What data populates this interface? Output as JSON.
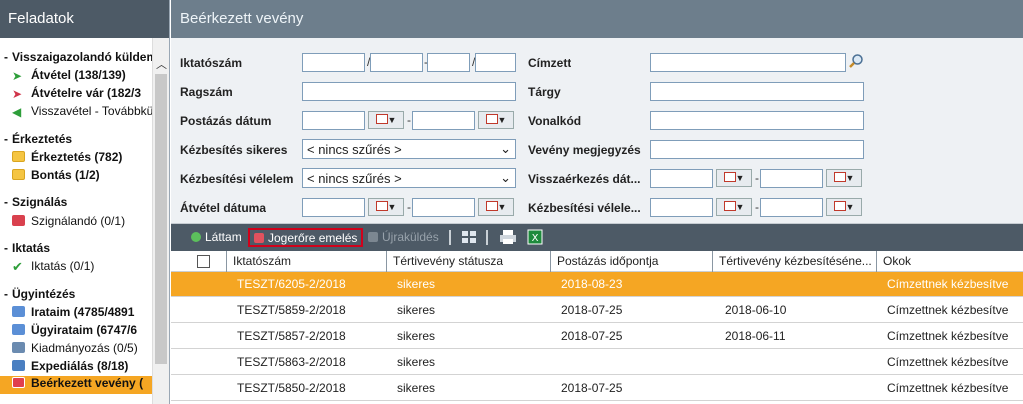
{
  "left": {
    "title": "Feladatok",
    "groups": [
      {
        "label": "Visszaigazolandó küldemények",
        "items": [
          {
            "label": "Átvétel (138/139)",
            "icon": "arrow-right-green-icon",
            "bold": true
          },
          {
            "label": "Átvételre vár (182/3",
            "icon": "arrow-right-red-icon",
            "bold": true
          },
          {
            "label": "Visszavétel - Továbbküldés",
            "icon": "arrow-left-green-icon",
            "bold": false
          }
        ]
      },
      {
        "label": "Érkeztetés",
        "items": [
          {
            "label": "Érkeztetés (782)",
            "icon": "folder-icon",
            "bold": true
          },
          {
            "label": "Bontás (1/2)",
            "icon": "folder-icon",
            "bold": true
          }
        ]
      },
      {
        "label": "Szignálás",
        "items": [
          {
            "label": "Szignálandó (0/1)",
            "icon": "mail-red-icon",
            "bold": false
          }
        ]
      },
      {
        "label": "Iktatás",
        "items": [
          {
            "label": "Iktatás (0/1)",
            "icon": "check-icon",
            "bold": false
          }
        ]
      },
      {
        "label": "Ügyintézés",
        "items": [
          {
            "label": "Irataim (4785/4891",
            "icon": "document-blue-icon",
            "bold": true
          },
          {
            "label": "Ügyirataim (6747/6",
            "icon": "document-blue-icon",
            "bold": true
          },
          {
            "label": "Kiadmányozás (0/5)",
            "icon": "stamp-icon",
            "bold": false
          },
          {
            "label": "Expediálás (8/18)",
            "icon": "send-icon",
            "bold": true
          },
          {
            "label": "Beérkezett vevény (",
            "icon": "receipt-red-icon",
            "bold": true,
            "selected": true
          }
        ]
      }
    ]
  },
  "right": {
    "title": "Beérkezett vevény"
  },
  "filter": {
    "iktatoszam": "Iktatószám",
    "iktatoszam_sep1": "/",
    "iktatoszam_sep2": "-",
    "iktatoszam_sep3": "/",
    "cimzett": "Címzett",
    "ragszam": "Ragszám",
    "targy": "Tárgy",
    "postazas_datum": "Postázás dátum",
    "vonalkod": "Vonalkód",
    "kezbesites_sikeres": "Kézbesítés sikeres",
    "kezbesites_sikeres_value": "< nincs szűrés >",
    "veveny_megjegyzes": "Vevény megjegyzés",
    "kezbesitesi_velelem": "Kézbesítési vélelem",
    "kezbesitesi_velelem_value": "< nincs szűrés >",
    "visszaerkezes_dat": "Visszaérkezés dát...",
    "atvetel_datuma": "Átvétel dátuma",
    "kezbesitesi_velele": "Kézbesítési vélele...",
    "range_sep": "-"
  },
  "toolbar": {
    "lattam": "Láttam",
    "jogerore_emeles": "Jogerőre emelés",
    "ujrakuldes": "Újraküldés"
  },
  "table": {
    "columns": [
      "Iktatószám",
      "Tértivevény státusza",
      "Postázás időpontja",
      "Tértivevény kézbesítéséne...",
      "Okok"
    ],
    "rows": [
      {
        "iktatoszam": "TESZT/6205-2/2018",
        "statusz": "sikeres",
        "postazas": "2018-08-23",
        "kezbesites": "",
        "okok": "Címzettnek kézbesítve",
        "selected": true
      },
      {
        "iktatoszam": "TESZT/5859-2/2018",
        "statusz": "sikeres",
        "postazas": "2018-07-25",
        "kezbesites": "2018-06-10",
        "okok": "Címzettnek kézbesítve"
      },
      {
        "iktatoszam": "TESZT/5857-2/2018",
        "statusz": "sikeres",
        "postazas": "2018-07-25",
        "kezbesites": "2018-06-11",
        "okok": "Címzettnek kézbesítve"
      },
      {
        "iktatoszam": "TESZT/5863-2/2018",
        "statusz": "sikeres",
        "postazas": "",
        "kezbesites": "",
        "okok": "Címzettnek kézbesítve"
      },
      {
        "iktatoszam": "TESZT/5850-2/2018",
        "statusz": "sikeres",
        "postazas": "2018-07-25",
        "kezbesites": "",
        "okok": "Címzettnek kézbesítve"
      }
    ]
  }
}
